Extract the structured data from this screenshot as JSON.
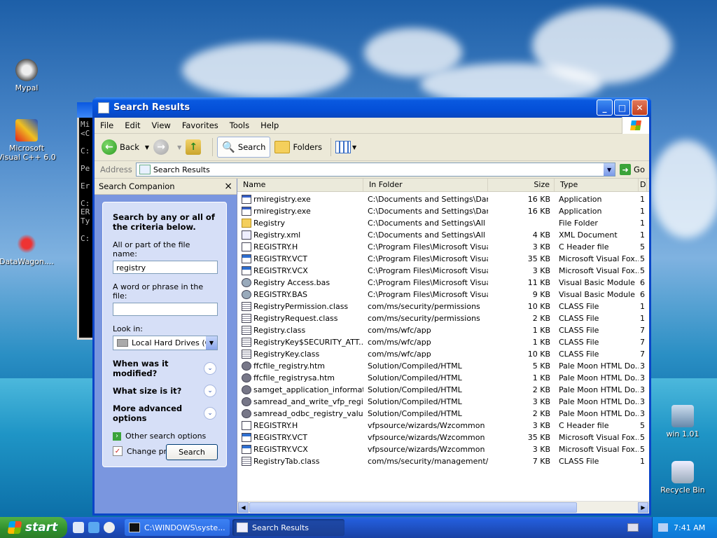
{
  "desktop": {
    "icons": [
      {
        "label": "Mypal"
      },
      {
        "label": "Microsoft Visual C++ 6.0"
      },
      {
        "label": "DataWagon...."
      },
      {
        "label": "win 1.01"
      },
      {
        "label": "Recycle Bin"
      }
    ]
  },
  "console": {
    "lines": [
      "Mi",
      "<C",
      "",
      "C:",
      "",
      "Pe",
      "",
      "Er",
      "",
      "C:",
      "ER",
      "Ty",
      "",
      "C:"
    ]
  },
  "window": {
    "title": "Search Results",
    "menu": [
      "File",
      "Edit",
      "View",
      "Favorites",
      "Tools",
      "Help"
    ],
    "toolbar": {
      "back": "Back",
      "search": "Search",
      "folders": "Folders"
    },
    "address": {
      "label": "Address",
      "value": "Search Results",
      "go": "Go"
    }
  },
  "companion": {
    "header": "Search Companion",
    "close": "×",
    "heading": "Search by any or all of the criteria below.",
    "filename_label": "All or part of the file name:",
    "filename_value": "registry",
    "phrase_label": "A word or phrase in the file:",
    "phrase_value": "",
    "lookin_label": "Look in:",
    "lookin_value": "Local Hard Drives (C:)",
    "modified": "When was it modified?",
    "size": "What size is it?",
    "advanced": "More advanced options",
    "other_options": "Other search options",
    "change_prefs": "Change preferences",
    "search_button": "Search"
  },
  "columns": [
    "Name",
    "In Folder",
    "Size",
    "Type",
    "D"
  ],
  "files": [
    {
      "name": "rmiregistry.exe",
      "folder": "C:\\Documents and Settings\\Dart...",
      "size": "16 KB",
      "type": "Application",
      "d": "1",
      "icon": "app"
    },
    {
      "name": "rmiregistry.exe",
      "folder": "C:\\Documents and Settings\\Dart...",
      "size": "16 KB",
      "type": "Application",
      "d": "1",
      "icon": "app"
    },
    {
      "name": "Registry",
      "folder": "C:\\Documents and Settings\\All U...",
      "size": "",
      "type": "File Folder",
      "d": "1",
      "icon": "folder"
    },
    {
      "name": "Registry.xml",
      "folder": "C:\\Documents and Settings\\All U...",
      "size": "4 KB",
      "type": "XML Document",
      "d": "1",
      "icon": "xml"
    },
    {
      "name": "REGISTRY.H",
      "folder": "C:\\Program Files\\Microsoft Visua...",
      "size": "3 KB",
      "type": "C Header file",
      "d": "5",
      "icon": "h"
    },
    {
      "name": "REGISTRY.VCT",
      "folder": "C:\\Program Files\\Microsoft Visua...",
      "size": "35 KB",
      "type": "Microsoft Visual Fox...",
      "d": "5",
      "icon": "vfp"
    },
    {
      "name": "REGISTRY.VCX",
      "folder": "C:\\Program Files\\Microsoft Visua...",
      "size": "3 KB",
      "type": "Microsoft Visual Fox...",
      "d": "5",
      "icon": "vfp"
    },
    {
      "name": "Registry Access.bas",
      "folder": "C:\\Program Files\\Microsoft Visua...",
      "size": "11 KB",
      "type": "Visual Basic Module",
      "d": "6",
      "icon": "bas"
    },
    {
      "name": "REGISTRY.BAS",
      "folder": "C:\\Program Files\\Microsoft Visua...",
      "size": "9 KB",
      "type": "Visual Basic Module",
      "d": "6",
      "icon": "bas"
    },
    {
      "name": "RegistryPermission.class",
      "folder": "com/ms/security/permissions",
      "size": "10 KB",
      "type": "CLASS File",
      "d": "1",
      "icon": "cls"
    },
    {
      "name": "RegistryRequest.class",
      "folder": "com/ms/security/permissions",
      "size": "2 KB",
      "type": "CLASS File",
      "d": "1",
      "icon": "cls"
    },
    {
      "name": "Registry.class",
      "folder": "com/ms/wfc/app",
      "size": "1 KB",
      "type": "CLASS File",
      "d": "7",
      "icon": "cls"
    },
    {
      "name": "RegistryKey$SECURITY_ATT...",
      "folder": "com/ms/wfc/app",
      "size": "1 KB",
      "type": "CLASS File",
      "d": "7",
      "icon": "cls"
    },
    {
      "name": "RegistryKey.class",
      "folder": "com/ms/wfc/app",
      "size": "10 KB",
      "type": "CLASS File",
      "d": "7",
      "icon": "cls"
    },
    {
      "name": "ffcfile_registry.htm",
      "folder": "Solution/Compiled/HTML",
      "size": "5 KB",
      "type": "Pale Moon HTML Do...",
      "d": "3",
      "icon": "htm"
    },
    {
      "name": "ffcfile_registrysa.htm",
      "folder": "Solution/Compiled/HTML",
      "size": "1 KB",
      "type": "Pale Moon HTML Do...",
      "d": "3",
      "icon": "htm"
    },
    {
      "name": "samget_application_informati...",
      "folder": "Solution/Compiled/HTML",
      "size": "2 KB",
      "type": "Pale Moon HTML Do...",
      "d": "3",
      "icon": "htm"
    },
    {
      "name": "samread_and_write_vfp_regi...",
      "folder": "Solution/Compiled/HTML",
      "size": "3 KB",
      "type": "Pale Moon HTML Do...",
      "d": "3",
      "icon": "htm"
    },
    {
      "name": "samread_odbc_registry_valu...",
      "folder": "Solution/Compiled/HTML",
      "size": "2 KB",
      "type": "Pale Moon HTML Do...",
      "d": "3",
      "icon": "htm"
    },
    {
      "name": "REGISTRY.H",
      "folder": "vfpsource/wizards/Wzcommon",
      "size": "3 KB",
      "type": "C Header file",
      "d": "5",
      "icon": "h"
    },
    {
      "name": "REGISTRY.VCT",
      "folder": "vfpsource/wizards/Wzcommon",
      "size": "35 KB",
      "type": "Microsoft Visual Fox...",
      "d": "5",
      "icon": "vfp"
    },
    {
      "name": "REGISTRY.VCX",
      "folder": "vfpsource/wizards/Wzcommon",
      "size": "3 KB",
      "type": "Microsoft Visual Fox...",
      "d": "5",
      "icon": "vfp"
    },
    {
      "name": "RegistryTab.class",
      "folder": "com/ms/security/management/ui",
      "size": "7 KB",
      "type": "CLASS File",
      "d": "1",
      "icon": "cls"
    }
  ],
  "taskbar": {
    "start": "start",
    "tasks": [
      {
        "label": "C:\\WINDOWS\\syste...",
        "active": false
      },
      {
        "label": "Search Results",
        "active": true
      }
    ],
    "clock": "7:41 AM"
  }
}
